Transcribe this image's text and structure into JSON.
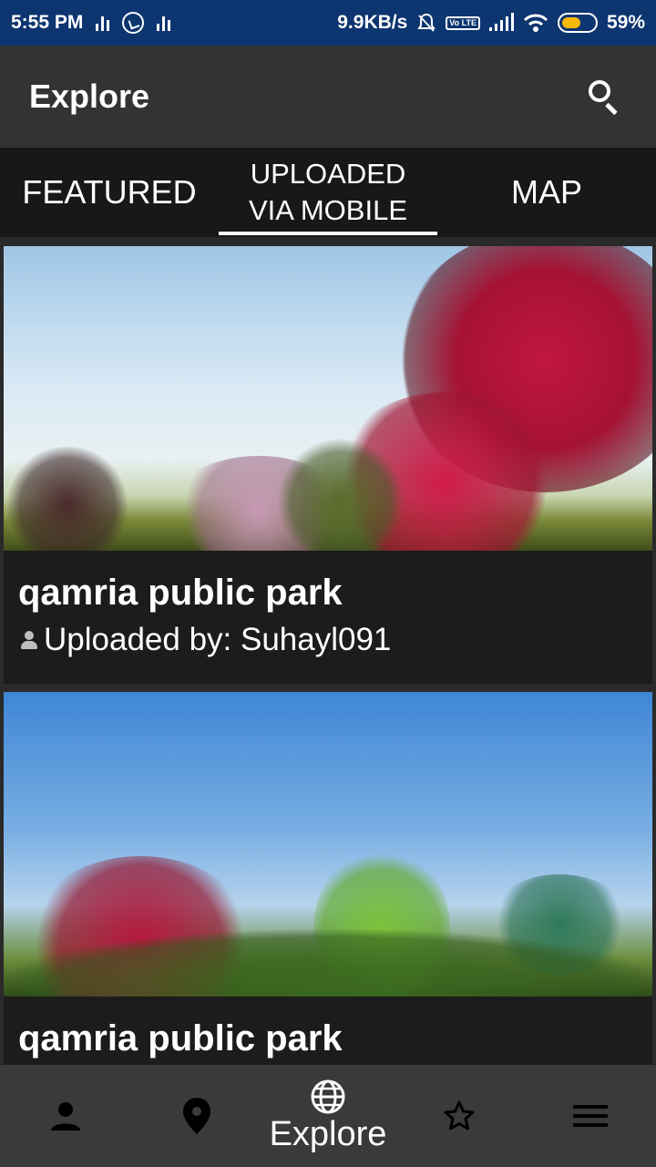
{
  "status_bar": {
    "time": "5:55 PM",
    "net_speed": "9.9KB/s",
    "volte": "Vo LTE",
    "battery": "59%",
    "battery_level": 0.59,
    "battery_color": "#f5b90a"
  },
  "app_bar": {
    "title": "Explore",
    "search_icon": "search-icon"
  },
  "tabs": [
    {
      "label": "FEATURED",
      "active": false
    },
    {
      "label": "UPLOADED VIA MOBILE",
      "active": true
    },
    {
      "label": "MAP",
      "active": false
    }
  ],
  "items": [
    {
      "title": "qamria public park",
      "meta_prefix": "Uploaded by: ",
      "uploader": "Suhayl091",
      "meta": "Uploaded by: Suhayl091"
    },
    {
      "title": "qamria public park"
    }
  ],
  "bottom_nav": {
    "items": [
      {
        "icon": "person-icon",
        "label": ""
      },
      {
        "icon": "location-pin-icon",
        "label": ""
      },
      {
        "icon": "globe-icon",
        "label": "Explore",
        "active": true
      },
      {
        "icon": "star-icon",
        "label": ""
      },
      {
        "icon": "menu-icon",
        "label": ""
      }
    ]
  },
  "colors": {
    "status_bar": "#0d3570",
    "app_bar": "#333333",
    "tab_bar": "#181818",
    "card": "#1c1c1c",
    "bottom_nav": "#3a3a3a"
  }
}
